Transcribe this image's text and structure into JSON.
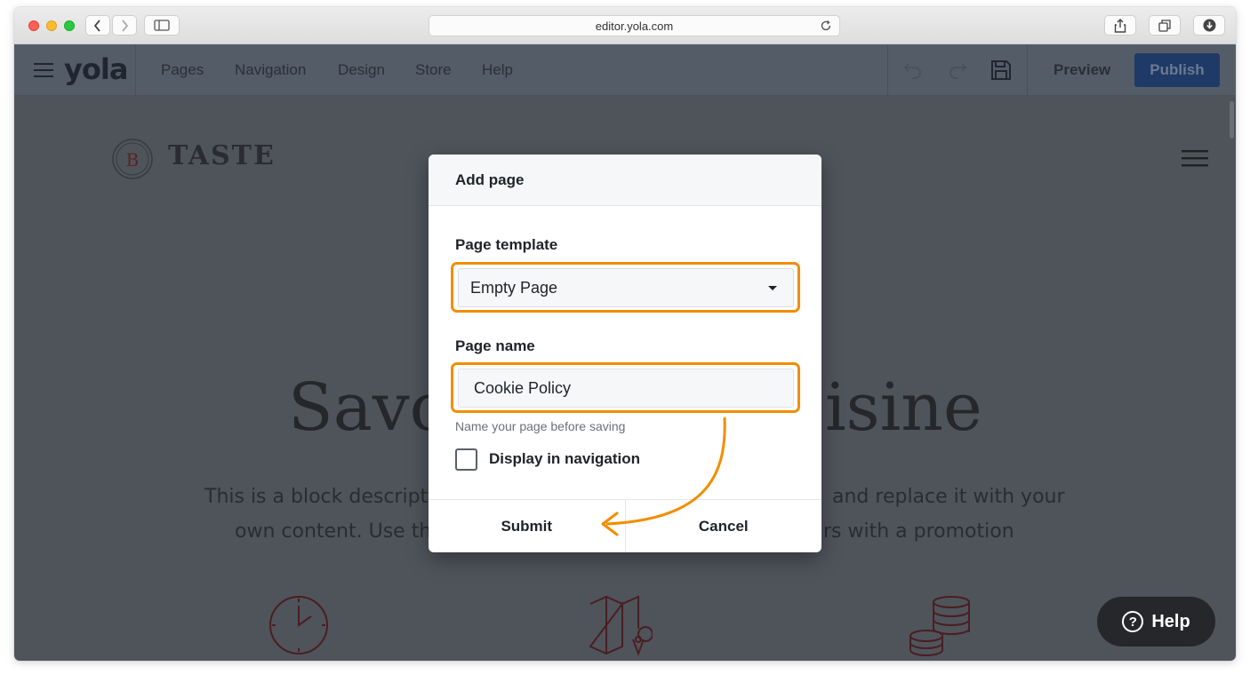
{
  "browser": {
    "url": "editor.yola.com"
  },
  "editor": {
    "logo": "yola",
    "menu": [
      "Pages",
      "Navigation",
      "Design",
      "Store",
      "Help"
    ],
    "preview_label": "Preview",
    "publish_label": "Publish"
  },
  "site": {
    "brand_letter": "B",
    "brand_name": "TASTE",
    "hero_left": "Savo",
    "hero_right": "isine",
    "desc_line1_left": "This is a block descriptio",
    "desc_line1_right": "and replace it with your",
    "desc_line2_left": "own content. Use this",
    "desc_line2_right": "rs with a promotion"
  },
  "modal": {
    "title": "Add page",
    "template_label": "Page template",
    "template_value": "Empty Page",
    "name_label": "Page name",
    "name_value": "Cookie Policy",
    "name_hint": "Name your page before saving",
    "nav_checkbox_label": "Display in navigation",
    "nav_checkbox_checked": false,
    "submit_label": "Submit",
    "cancel_label": "Cancel"
  },
  "help_widget": {
    "label": "Help",
    "icon_glyph": "?"
  },
  "colors": {
    "highlight": "#f28d00",
    "toolbar": "#545c68",
    "publish": "#1f3a66"
  }
}
